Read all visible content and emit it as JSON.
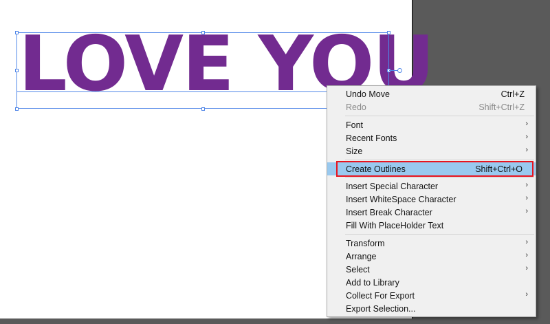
{
  "canvas": {
    "text": "LOVE YOU",
    "text_color": "#722b90",
    "selection_color": "#4f86e8"
  },
  "menu": {
    "items": [
      {
        "label": "Undo Move",
        "shortcut": "Ctrl+Z",
        "submenu": false,
        "enabled": true
      },
      {
        "label": "Redo",
        "shortcut": "Shift+Ctrl+Z",
        "submenu": false,
        "enabled": false
      },
      {
        "label": "Font",
        "shortcut": "",
        "submenu": true,
        "enabled": true
      },
      {
        "label": "Recent Fonts",
        "shortcut": "",
        "submenu": true,
        "enabled": true
      },
      {
        "label": "Size",
        "shortcut": "",
        "submenu": true,
        "enabled": true
      },
      {
        "label": "Create Outlines",
        "shortcut": "Shift+Ctrl+O",
        "submenu": false,
        "enabled": true,
        "highlighted": true
      },
      {
        "label": "Insert Special Character",
        "shortcut": "",
        "submenu": true,
        "enabled": true
      },
      {
        "label": "Insert WhiteSpace Character",
        "shortcut": "",
        "submenu": true,
        "enabled": true
      },
      {
        "label": "Insert Break Character",
        "shortcut": "",
        "submenu": true,
        "enabled": true
      },
      {
        "label": "Fill With PlaceHolder Text",
        "shortcut": "",
        "submenu": false,
        "enabled": true
      },
      {
        "label": "Transform",
        "shortcut": "",
        "submenu": true,
        "enabled": true
      },
      {
        "label": "Arrange",
        "shortcut": "",
        "submenu": true,
        "enabled": true
      },
      {
        "label": "Select",
        "shortcut": "",
        "submenu": true,
        "enabled": true
      },
      {
        "label": "Add to Library",
        "shortcut": "",
        "submenu": false,
        "enabled": true
      },
      {
        "label": "Collect For Export",
        "shortcut": "",
        "submenu": true,
        "enabled": true
      },
      {
        "label": "Export Selection...",
        "shortcut": "",
        "submenu": false,
        "enabled": true
      }
    ],
    "highlight_color": "#99c9ef",
    "annotation_color": "#e8141e"
  }
}
